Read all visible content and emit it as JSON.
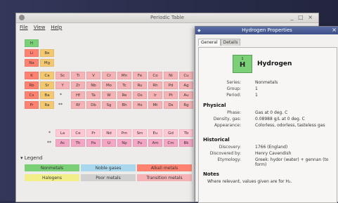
{
  "main_window": {
    "title": "Periodic Table",
    "controls": "_ □ ×",
    "menu": [
      "File",
      "View",
      "Help"
    ]
  },
  "table": {
    "row1": [
      "H"
    ],
    "row2": [
      "Li",
      "Be"
    ],
    "row3": [
      "Na",
      "Mg"
    ],
    "row4": [
      "K",
      "Ca",
      "Sc",
      "Ti",
      "V",
      "Cr",
      "Mn",
      "Fe",
      "Co",
      "Ni",
      "Cu"
    ],
    "row5": [
      "Rb",
      "Sr",
      "Y",
      "Zr",
      "Nb",
      "Mo",
      "Tc",
      "Ru",
      "Rh",
      "Pd",
      "Ag"
    ],
    "row6": [
      "Cs",
      "Ba",
      "*",
      "Hf",
      "Ta",
      "W",
      "Re",
      "Os",
      "Ir",
      "Pt",
      "Au"
    ],
    "row7": [
      "Fr",
      "Ra",
      "**",
      "Rf",
      "Db",
      "Sg",
      "Bh",
      "Hs",
      "Mt",
      "Ds",
      "Rg"
    ],
    "lanthanides_marker": "*",
    "lanthanides": [
      "La",
      "Ce",
      "Pr",
      "Nd",
      "Pm",
      "Sm",
      "Eu",
      "Gd",
      "Tb"
    ],
    "actinides_marker": "**",
    "actinides": [
      "Ac",
      "Th",
      "Pa",
      "U",
      "Np",
      "Pu",
      "Am",
      "Cm",
      "Bk"
    ]
  },
  "legend": {
    "header": "Legend",
    "items": [
      "Nonmetals",
      "Noble gases",
      "Alkali metals",
      "Halogens",
      "Poor metals",
      "Transition metals"
    ]
  },
  "colors": {
    "nonmetal": "#7bcf77",
    "noble_gas": "#a9d8ee",
    "alkali_metal": "#ff8270",
    "alkaline_earth": "#f4c870",
    "transition": "#f5b3b6",
    "halogen": "#f2ee8a",
    "poor_metal": "#d0d0d0",
    "titlebar_active": "#3d4f86"
  },
  "properties_window": {
    "title": "Hydrogen Properties",
    "tabs": [
      "General",
      "Details"
    ],
    "element": {
      "number": "1",
      "symbol": "H",
      "name": "Hydrogen"
    },
    "basic": {
      "series_label": "Series:",
      "series": "Nonmetals",
      "group_label": "Group:",
      "group": "1",
      "period_label": "Period:",
      "period": "1"
    },
    "physical": {
      "header": "Physical",
      "phase_label": "Phase:",
      "phase": "Gas at 0 deg. C",
      "density_label": "Density, gas:",
      "density": "0.08988 g/L at 0 deg. C",
      "appearance_label": "Appearance:",
      "appearance": "Colorless, odorless, tasteless gas"
    },
    "historical": {
      "header": "Historical",
      "discovery_label": "Discovery:",
      "discovery": "1766 (England)",
      "discovered_by_label": "Discovered by:",
      "discovered_by": "Henry Cavendish",
      "etymology_label": "Etymology:",
      "etymology": "Greek: hydor (water) + gennan (to form)"
    },
    "notes": {
      "header": "Notes",
      "text": "Where relevant, values given are for H₂."
    }
  }
}
